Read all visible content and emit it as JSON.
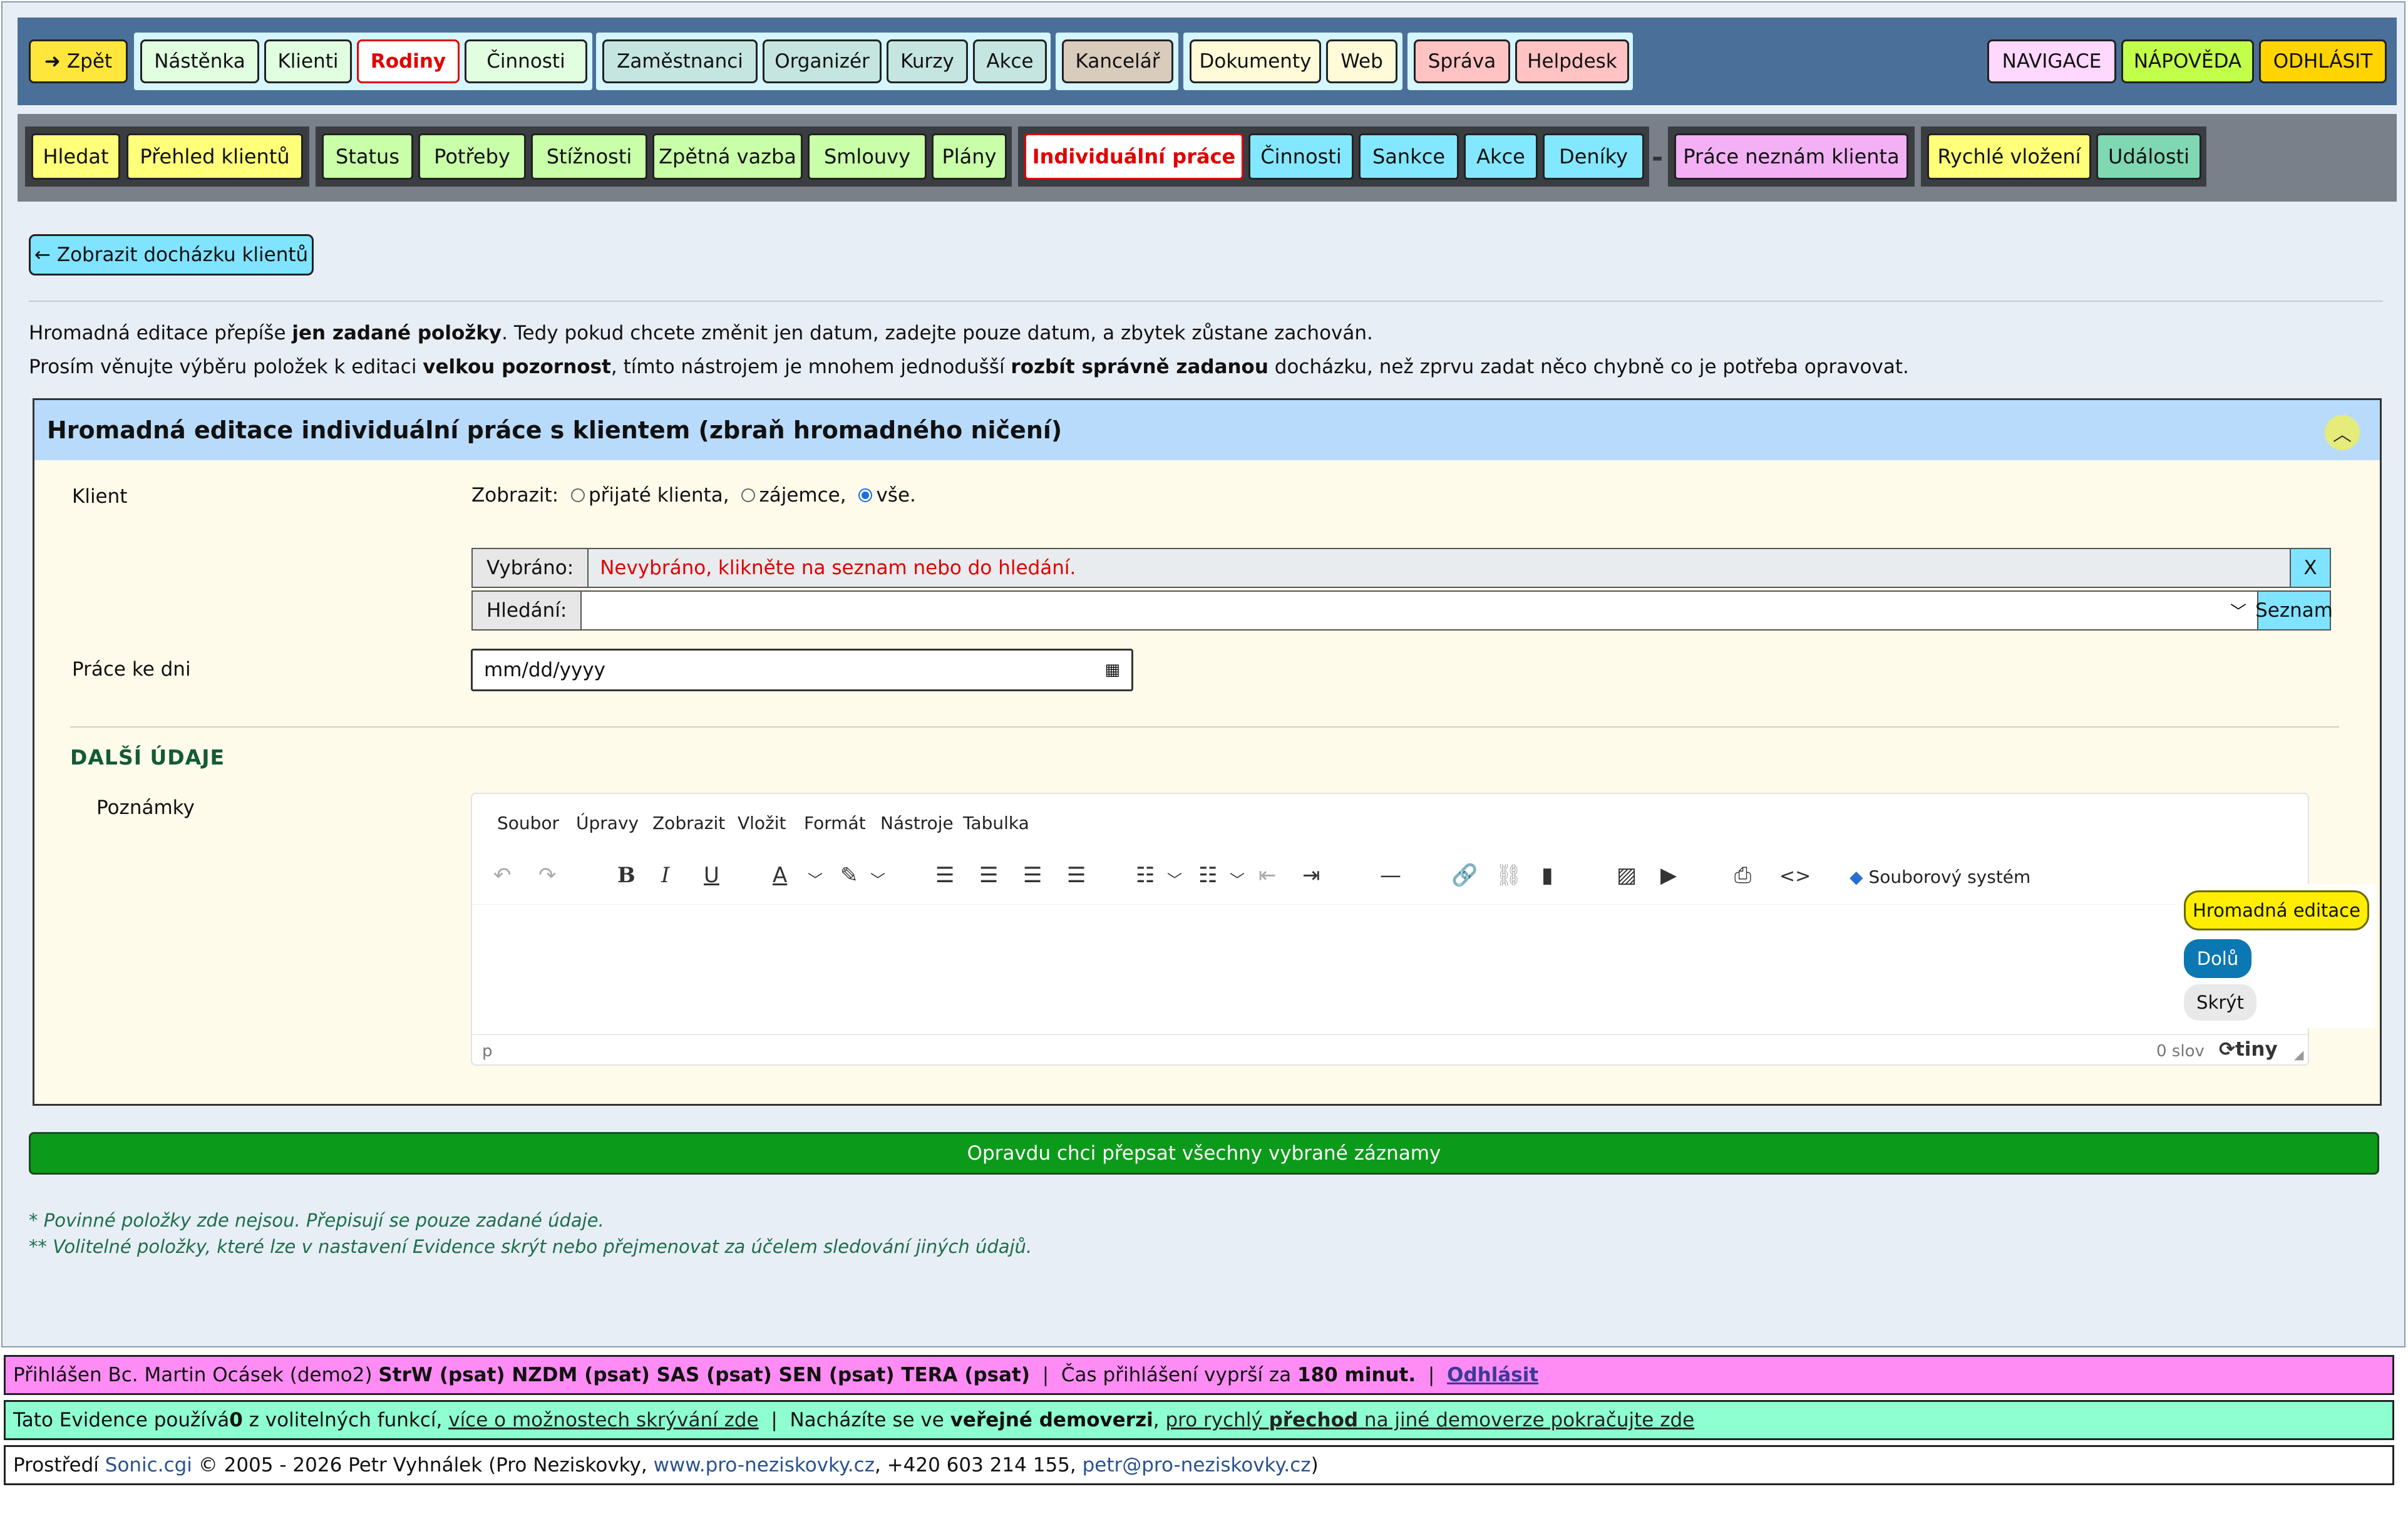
{
  "top_nav": {
    "back": "Zpět",
    "items": [
      "Nástěnka",
      "Klienti",
      "Rodiny",
      "Činnosti",
      "Zaměstnanci",
      "Organizér",
      "Kurzy",
      "Akce",
      "Kancelář",
      "Dokumenty",
      "Web",
      "Správa",
      "Helpdesk"
    ],
    "active": "Rodiny",
    "right": [
      "NAVIGACE",
      "NÁPOVĚDA",
      "ODHLÁSIT"
    ]
  },
  "sub_nav": {
    "items": [
      "Hledat",
      "Přehled klientů",
      "Status",
      "Potřeby",
      "Stížnosti",
      "Zpětná vazba",
      "Smlouvy",
      "Plány",
      "Individuální práce",
      "Činnosti",
      "Sankce",
      "Akce",
      "Deníky",
      "Práce neznám klienta",
      "Rychlé vložení",
      "Události"
    ],
    "active": "Individuální práce",
    "separator": "-"
  },
  "back_button": "Zobrazit docházku klientů",
  "info": {
    "line1_a": "Hromadná editace přepíše ",
    "line1_b": "jen zadané položky",
    "line1_c": ". Tedy pokud chcete změnit jen datum, zadejte pouze datum, a zbytek zůstane zachován.",
    "line2_a": "Prosím věnujte výběru položek k editaci ",
    "line2_b": "velkou pozornost",
    "line2_c": ", tímto nástrojem je mnohem jednodušší ",
    "line2_d": "rozbít správně zadanou",
    "line2_e": " docházku, než zprvu zadat něco chybně co je potřeba opravovat."
  },
  "panel": {
    "title": "Hromadná editace individuální práce s klientem (zbraň hromadného ničení)",
    "client_label": "Klient",
    "show_label": "Zobrazit:",
    "radio_options": [
      "přijaté klienta,",
      "zájemce,",
      "vše."
    ],
    "radio_selected": "vše.",
    "selected_label": "Vybráno:",
    "selected_value": "Nevybráno, klikněte na seznam nebo do hledání.",
    "clear_button": "X",
    "search_label": "Hledání:",
    "search_value": "",
    "list_button": "Seznam",
    "date_label": "Práce ke dni",
    "date_placeholder": "mm/dd/yyyy",
    "section_title": "DALŠÍ ÚDAJE",
    "notes_label": "Poznámky"
  },
  "editor": {
    "menu": [
      "Soubor",
      "Úpravy",
      "Zobrazit",
      "Vložit",
      "Formát",
      "Nástroje",
      "Tabulka"
    ],
    "filesystem": "Souborový systém",
    "status_path": "p",
    "word_count": "0 slov",
    "brand": "tiny"
  },
  "floating": {
    "mass_edit": "Hromadná editace",
    "down": "Dolů",
    "hide": "Skrýt"
  },
  "submit_button": "Opravdu chci přepsat všechny vybrané záznamy",
  "notes": [
    "* Povinné položky zde nejsou. Přepisují se pouze zadané údaje.",
    "** Volitelné položky, které lze v nastavení Evidence skrýt nebo přejmenovat za účelem sledování jiných údajů."
  ],
  "footer": {
    "login_a": "Přihlášen Bc. Martin Ocásek (demo2) ",
    "login_roles": "StrW (psat) NZDM (psat) SAS (psat) SEN (psat) TERA (psat)",
    "login_expiry_a": "  |  Čas přihlášení vyprší za ",
    "login_expiry_b": "180 minut.",
    "logout": "Odhlásit",
    "evidence_a": "Tato Evidence používá ",
    "evidence_count": "0",
    "evidence_b": " z volitelných funkcí, ",
    "evidence_link": "více o možnostech skrývání zde",
    "evidence_c": "  |  Nacházíte se ve ",
    "evidence_public": "veřejné demoverzi",
    "evidence_sep": ", ",
    "evidence_link2a": "pro rychlý ",
    "evidence_link2b": "přechod",
    "evidence_link2c": " na jiné demoverze pokračujte zde",
    "env_a": "Prostředí ",
    "env_sonic": "Sonic.cgi",
    "env_b": " © 2005 - 2026 Petr Vyhnálek (Pro Neziskovky, ",
    "env_web": "www.pro-neziskovky.cz",
    "env_c": ", +420 603 214 155, ",
    "env_mail": "petr@pro-neziskovky.cz",
    "env_d": ")"
  },
  "colors": {
    "top_bar": "#4a6f98",
    "active_tab_text": "#e00000",
    "submit_green": "#0c9a1a",
    "footer_pink": "#ff8cf5",
    "footer_mint": "#8dffd0"
  }
}
